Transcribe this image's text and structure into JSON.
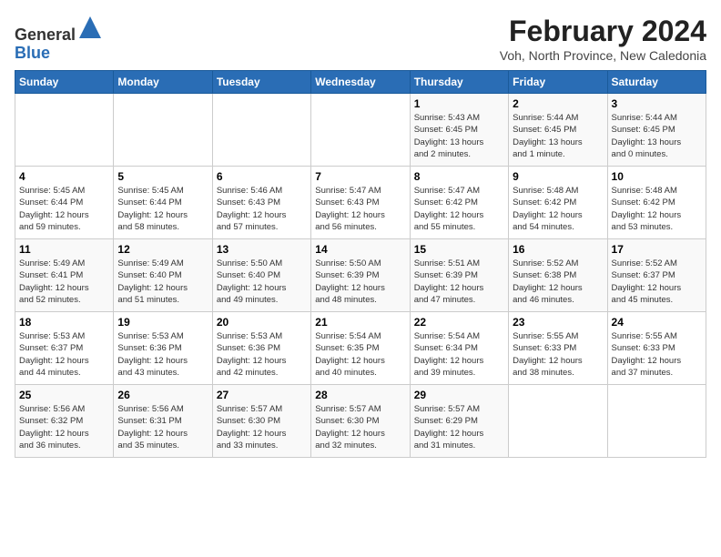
{
  "header": {
    "logo_line1": "General",
    "logo_line2": "Blue",
    "month": "February 2024",
    "location": "Voh, North Province, New Caledonia"
  },
  "days_of_week": [
    "Sunday",
    "Monday",
    "Tuesday",
    "Wednesday",
    "Thursday",
    "Friday",
    "Saturday"
  ],
  "weeks": [
    [
      {
        "day": "",
        "info": ""
      },
      {
        "day": "",
        "info": ""
      },
      {
        "day": "",
        "info": ""
      },
      {
        "day": "",
        "info": ""
      },
      {
        "day": "1",
        "info": "Sunrise: 5:43 AM\nSunset: 6:45 PM\nDaylight: 13 hours\nand 2 minutes."
      },
      {
        "day": "2",
        "info": "Sunrise: 5:44 AM\nSunset: 6:45 PM\nDaylight: 13 hours\nand 1 minute."
      },
      {
        "day": "3",
        "info": "Sunrise: 5:44 AM\nSunset: 6:45 PM\nDaylight: 13 hours\nand 0 minutes."
      }
    ],
    [
      {
        "day": "4",
        "info": "Sunrise: 5:45 AM\nSunset: 6:44 PM\nDaylight: 12 hours\nand 59 minutes."
      },
      {
        "day": "5",
        "info": "Sunrise: 5:45 AM\nSunset: 6:44 PM\nDaylight: 12 hours\nand 58 minutes."
      },
      {
        "day": "6",
        "info": "Sunrise: 5:46 AM\nSunset: 6:43 PM\nDaylight: 12 hours\nand 57 minutes."
      },
      {
        "day": "7",
        "info": "Sunrise: 5:47 AM\nSunset: 6:43 PM\nDaylight: 12 hours\nand 56 minutes."
      },
      {
        "day": "8",
        "info": "Sunrise: 5:47 AM\nSunset: 6:42 PM\nDaylight: 12 hours\nand 55 minutes."
      },
      {
        "day": "9",
        "info": "Sunrise: 5:48 AM\nSunset: 6:42 PM\nDaylight: 12 hours\nand 54 minutes."
      },
      {
        "day": "10",
        "info": "Sunrise: 5:48 AM\nSunset: 6:42 PM\nDaylight: 12 hours\nand 53 minutes."
      }
    ],
    [
      {
        "day": "11",
        "info": "Sunrise: 5:49 AM\nSunset: 6:41 PM\nDaylight: 12 hours\nand 52 minutes."
      },
      {
        "day": "12",
        "info": "Sunrise: 5:49 AM\nSunset: 6:40 PM\nDaylight: 12 hours\nand 51 minutes."
      },
      {
        "day": "13",
        "info": "Sunrise: 5:50 AM\nSunset: 6:40 PM\nDaylight: 12 hours\nand 49 minutes."
      },
      {
        "day": "14",
        "info": "Sunrise: 5:50 AM\nSunset: 6:39 PM\nDaylight: 12 hours\nand 48 minutes."
      },
      {
        "day": "15",
        "info": "Sunrise: 5:51 AM\nSunset: 6:39 PM\nDaylight: 12 hours\nand 47 minutes."
      },
      {
        "day": "16",
        "info": "Sunrise: 5:52 AM\nSunset: 6:38 PM\nDaylight: 12 hours\nand 46 minutes."
      },
      {
        "day": "17",
        "info": "Sunrise: 5:52 AM\nSunset: 6:37 PM\nDaylight: 12 hours\nand 45 minutes."
      }
    ],
    [
      {
        "day": "18",
        "info": "Sunrise: 5:53 AM\nSunset: 6:37 PM\nDaylight: 12 hours\nand 44 minutes."
      },
      {
        "day": "19",
        "info": "Sunrise: 5:53 AM\nSunset: 6:36 PM\nDaylight: 12 hours\nand 43 minutes."
      },
      {
        "day": "20",
        "info": "Sunrise: 5:53 AM\nSunset: 6:36 PM\nDaylight: 12 hours\nand 42 minutes."
      },
      {
        "day": "21",
        "info": "Sunrise: 5:54 AM\nSunset: 6:35 PM\nDaylight: 12 hours\nand 40 minutes."
      },
      {
        "day": "22",
        "info": "Sunrise: 5:54 AM\nSunset: 6:34 PM\nDaylight: 12 hours\nand 39 minutes."
      },
      {
        "day": "23",
        "info": "Sunrise: 5:55 AM\nSunset: 6:33 PM\nDaylight: 12 hours\nand 38 minutes."
      },
      {
        "day": "24",
        "info": "Sunrise: 5:55 AM\nSunset: 6:33 PM\nDaylight: 12 hours\nand 37 minutes."
      }
    ],
    [
      {
        "day": "25",
        "info": "Sunrise: 5:56 AM\nSunset: 6:32 PM\nDaylight: 12 hours\nand 36 minutes."
      },
      {
        "day": "26",
        "info": "Sunrise: 5:56 AM\nSunset: 6:31 PM\nDaylight: 12 hours\nand 35 minutes."
      },
      {
        "day": "27",
        "info": "Sunrise: 5:57 AM\nSunset: 6:30 PM\nDaylight: 12 hours\nand 33 minutes."
      },
      {
        "day": "28",
        "info": "Sunrise: 5:57 AM\nSunset: 6:30 PM\nDaylight: 12 hours\nand 32 minutes."
      },
      {
        "day": "29",
        "info": "Sunrise: 5:57 AM\nSunset: 6:29 PM\nDaylight: 12 hours\nand 31 minutes."
      },
      {
        "day": "",
        "info": ""
      },
      {
        "day": "",
        "info": ""
      }
    ]
  ]
}
